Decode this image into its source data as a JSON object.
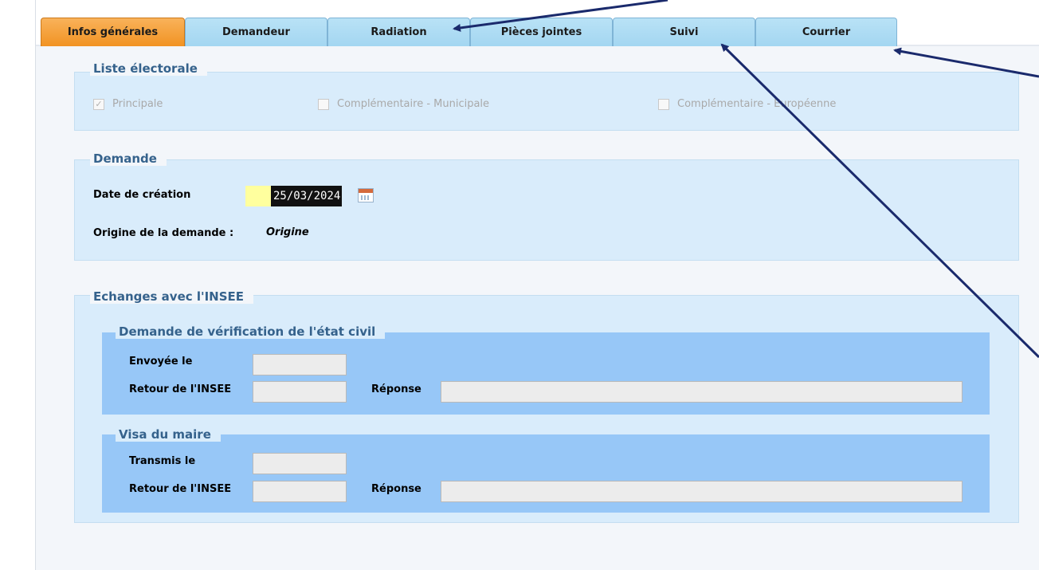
{
  "tabs": [
    {
      "label": "Infos générales",
      "active": true
    },
    {
      "label": "Demandeur",
      "active": false
    },
    {
      "label": "Radiation",
      "active": false
    },
    {
      "label": "Pièces jointes",
      "active": false
    },
    {
      "label": "Suivi",
      "active": false
    },
    {
      "label": "Courrier",
      "active": false
    }
  ],
  "liste_electorale": {
    "legend": "Liste électorale",
    "options": [
      {
        "label": "Principale",
        "checked": true
      },
      {
        "label": "Complémentaire - Municipale",
        "checked": false
      },
      {
        "label": "Complémentaire - Européenne",
        "checked": false
      }
    ]
  },
  "demande": {
    "legend": "Demande",
    "date_label": "Date de création",
    "date_value": "25/03/2024",
    "origin_label": "Origine de la demande :",
    "origin_value": "Origine"
  },
  "insee": {
    "legend": "Echanges avec l'INSEE",
    "verification": {
      "legend": "Demande de vérification de l'état civil",
      "sent_label": "Envoyée le",
      "return_label": "Retour de l'INSEE",
      "response_label": "Réponse"
    },
    "visa": {
      "legend": "Visa du maire",
      "sent_label": "Transmis le",
      "return_label": "Retour de l'INSEE",
      "response_label": "Réponse"
    }
  },
  "colors": {
    "tab_active": "#f19323",
    "tab_inactive": "#a3d6f1",
    "group_bg": "#d9ecfb",
    "subgroup_bg": "#97c7f7",
    "legend_text": "#35628c",
    "date_highlight": "#ffff9e",
    "annotation_arrows": "#1a2a6c"
  }
}
